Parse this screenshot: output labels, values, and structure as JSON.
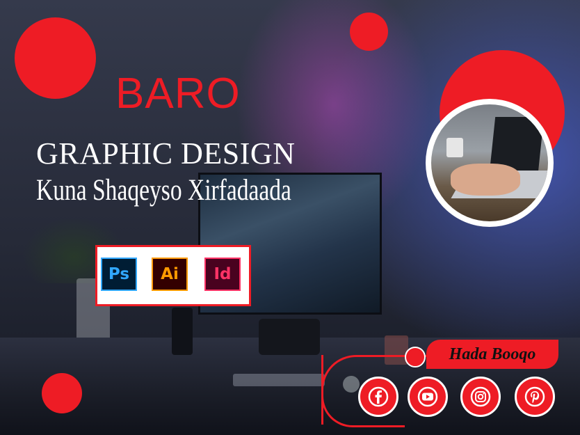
{
  "headline": {
    "baro": "BARO",
    "subject": "GRAPHIC DESIGN",
    "tagline": "Kuna Shaqeyso Xirfadaada"
  },
  "software_badges": [
    {
      "label": "Ps",
      "icon": "photoshop-icon"
    },
    {
      "label": "Ai",
      "icon": "illustrator-icon"
    },
    {
      "label": "Id",
      "icon": "indesign-icon"
    }
  ],
  "cta": {
    "label": "Hada Booqo"
  },
  "social": [
    {
      "icon": "facebook-icon"
    },
    {
      "icon": "youtube-icon"
    },
    {
      "icon": "instagram-icon"
    },
    {
      "icon": "pinterest-icon"
    }
  ],
  "colors": {
    "accent": "#ee1c25",
    "text": "#ffffff",
    "background": "#262a38"
  }
}
